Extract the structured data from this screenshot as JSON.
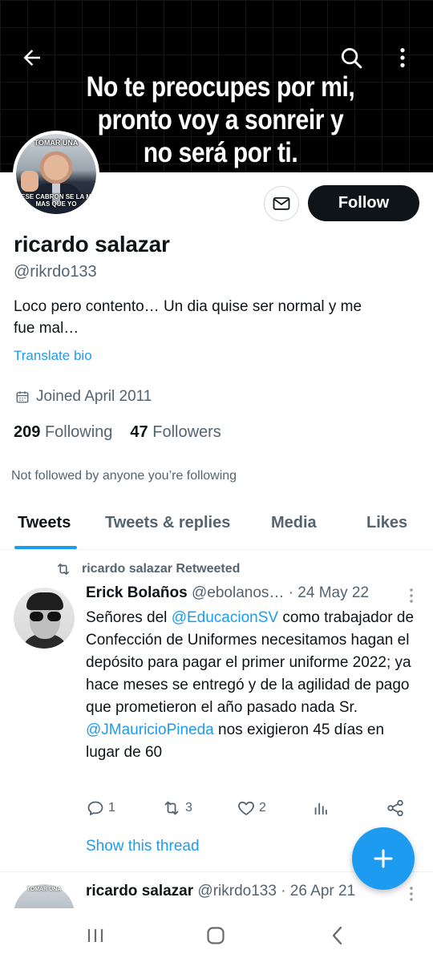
{
  "banner": {
    "lines": [
      "No te preocupes por mi,",
      "pronto voy a sonreir y",
      "no será por ti."
    ]
  },
  "avatar": {
    "caption_top": "TOMAR UNA",
    "caption_bottom_1": "ESE CABRON SE LA M",
    "caption_bottom_2": "MAS QUE YO"
  },
  "profile": {
    "follow_label": "Follow",
    "name": "ricardo salazar",
    "handle": "@rikrdo133",
    "bio_line1": "Loco pero contento… Un dia quise ser normal y me",
    "bio_line2": "fue mal…",
    "translate_label": "Translate bio",
    "joined": "Joined April 2011",
    "following_count": "209",
    "following_label": "Following",
    "followers_count": "47",
    "followers_label": "Followers",
    "not_followed": "Not followed by anyone you’re following"
  },
  "tabs": [
    "Tweets",
    "Tweets & replies",
    "Media",
    "Likes"
  ],
  "tweet": {
    "retweet_label": "ricardo salazar Retweeted",
    "name": "Erick Bolaños",
    "handle": "@ebolanos…",
    "date": "· 24 May 22",
    "text_1": "Señores del ",
    "mention_1": "@EducacionSV",
    "text_2": " como trabajador de Confección de Uniformes necesitamos hagan el depósito para pagar el primer uniforme 2022; ya hace meses se entregó y de la agilidad de pago que prometieron el año pasado nada Sr. ",
    "mention_2": "@JMauricioPineda",
    "text_3": " nos exigieron 45 días en lugar de 60",
    "replies": "1",
    "retweets": "3",
    "likes": "2",
    "show_thread": "Show this thread"
  },
  "tweet2": {
    "avatar_caption": "TOMAR UNA",
    "name": "ricardo salazar",
    "handle": "@rikrdo133",
    "date": "· 26 Apr 21"
  },
  "colors": {
    "accent": "#1d9bf0",
    "text_primary": "#0f1419",
    "text_secondary": "#536471"
  },
  "icons": [
    "back-arrow-icon",
    "search-icon",
    "more-vertical-icon",
    "envelope-icon",
    "calendar-icon",
    "retweet-icon",
    "reply-icon",
    "like-icon",
    "analytics-icon",
    "share-icon",
    "compose-plus-icon",
    "recents-icon",
    "home-icon",
    "back-chevron-icon"
  ]
}
